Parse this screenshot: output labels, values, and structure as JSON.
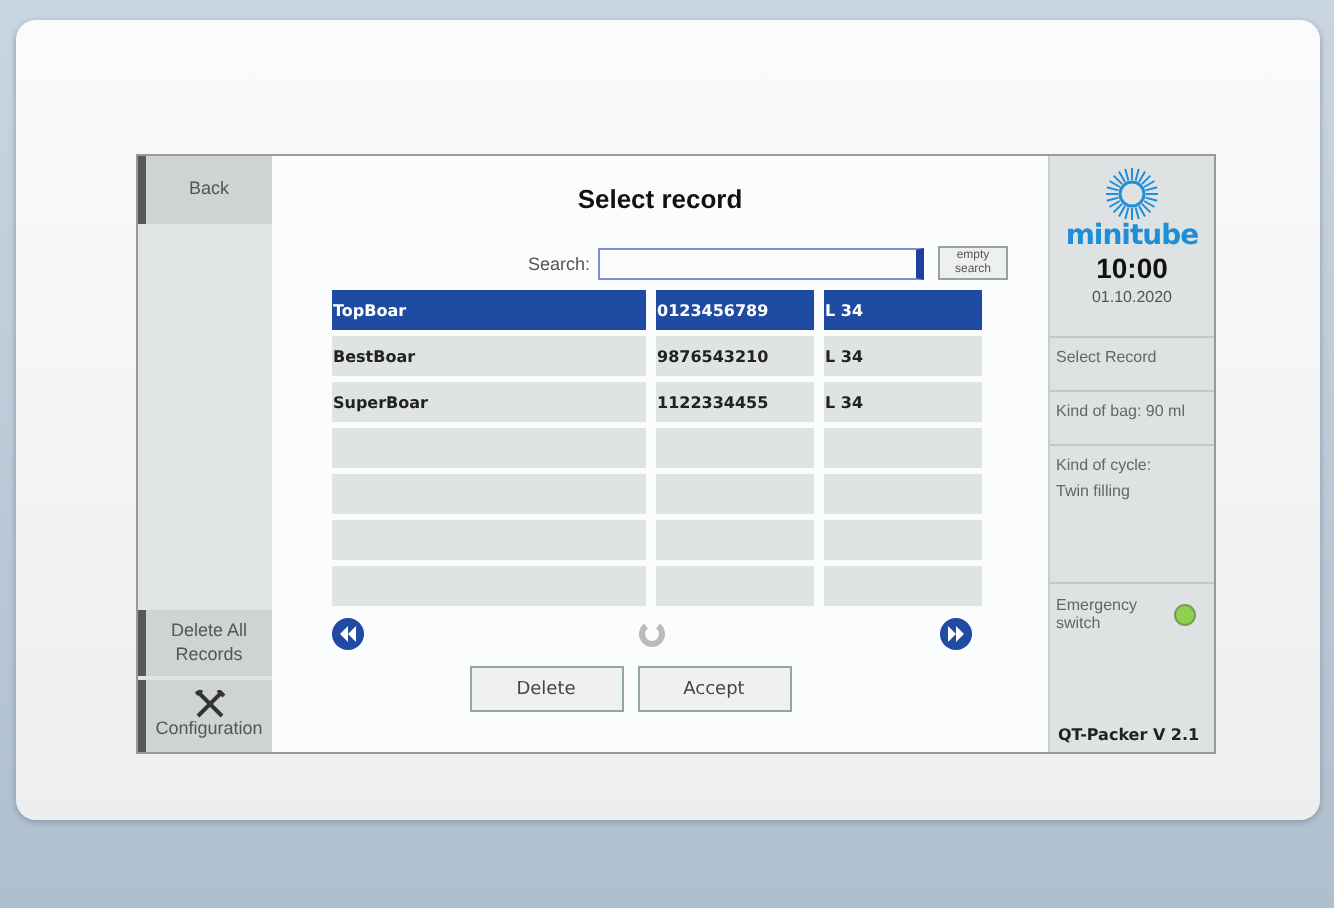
{
  "sidebar": {
    "top_button": "Back",
    "bottom_buttons": [
      {
        "label": "Delete All Records",
        "kind": "text"
      },
      {
        "label": "Configuration",
        "kind": "tool"
      }
    ]
  },
  "title": "Select record",
  "search": {
    "label": "Search:",
    "clear_button": "empty search"
  },
  "table": {
    "rows": [
      {
        "cells": [
          "TopBoar",
          "0123456789",
          "L 34"
        ],
        "selected": true
      },
      {
        "cells": [
          "BestBoar",
          "9876543210",
          "L 34"
        ],
        "selected": false
      },
      {
        "cells": [
          "SuperBoar",
          "1122334455",
          "L 34"
        ],
        "selected": false
      }
    ]
  },
  "actions": [
    "Delete",
    "Accept"
  ],
  "status_panel": {
    "logo": "minitube",
    "time": "10:00",
    "date": "01.10.2020",
    "items": [
      {
        "lines": [
          "Select Record"
        ]
      },
      {
        "lines": [
          "Kind of bag: 90 ml"
        ]
      },
      {
        "lines": [
          "Kind of cycle:",
          "Twin filling"
        ]
      }
    ],
    "emergency": {
      "label": "Emergency switch",
      "color": "#8fd14f"
    },
    "version": "QT-Packer V 2.1"
  }
}
